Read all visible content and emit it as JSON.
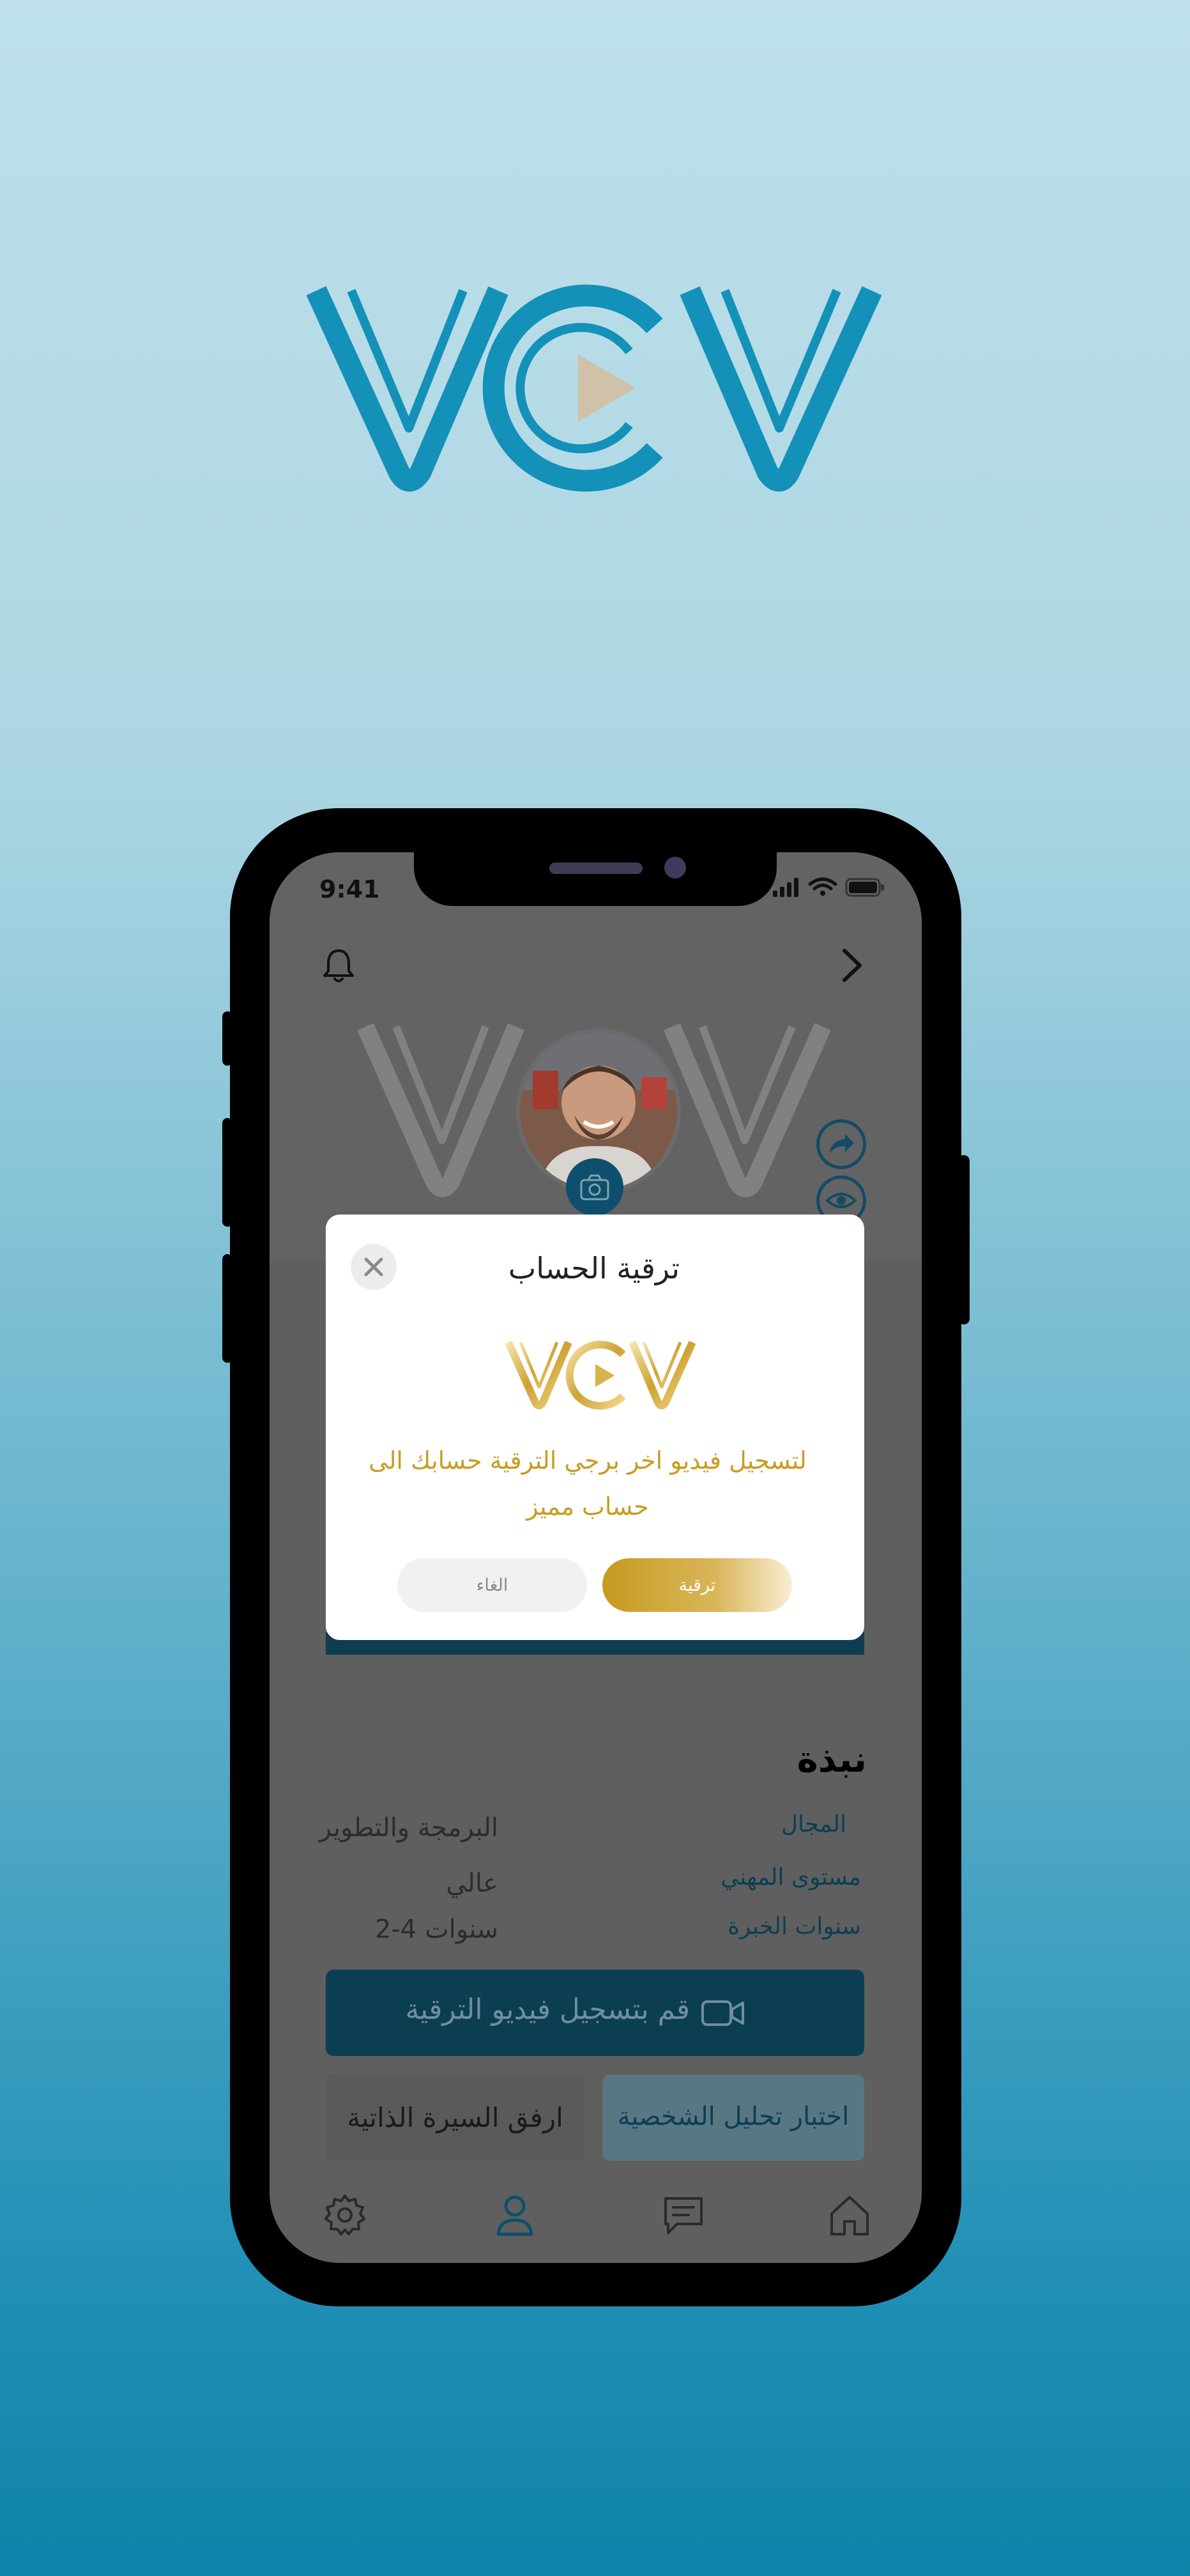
{
  "status_bar": {
    "time": "9:41"
  },
  "dialog": {
    "title": "ترقية الحساب",
    "message_line1": "لتسجيل فيديو اخر برجي الترقية  حسابك الى",
    "message_line2": "حساب مميز",
    "upgrade_label": "ترقية",
    "cancel_label": "الغاء"
  },
  "profile": {
    "section_title": "نبذة",
    "rows": [
      {
        "label": "المجال",
        "value": "البرمجة والتطوير"
      },
      {
        "label": "مستوى المهني",
        "value": "عالي"
      },
      {
        "label": "سنوات الخبرة",
        "value": "2-4 سنوات"
      }
    ]
  },
  "actions": {
    "record_label": "قم بتسجيل فيديو الترقية",
    "cv_label": "ارفق السيرة الذاتية",
    "personality_label": "اختبار تحليل الشخصية"
  },
  "colors": {
    "brand_blue": "#0f89b4",
    "gold": "#c79d22",
    "dark_teal": "#0c3e52"
  },
  "icons": [
    "bell-icon",
    "chevron-right-icon",
    "camera-icon",
    "share-icon",
    "eye-icon",
    "close-icon",
    "video-camera-icon",
    "settings-icon",
    "user-icon",
    "chat-icon",
    "home-icon"
  ]
}
